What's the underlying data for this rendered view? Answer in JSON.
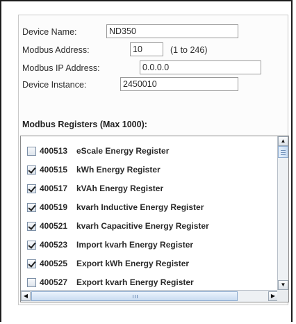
{
  "device": {
    "name_label": "Device Name:",
    "name_value": "ND350",
    "modbus_address_label": "Modbus Address:",
    "modbus_address_value": "10",
    "modbus_address_range": "(1 to 246)",
    "modbus_ip_label": "Modbus IP Address:",
    "modbus_ip_value": "0.0.0.0",
    "instance_label": "Device Instance:",
    "instance_value": "2450010"
  },
  "registers": {
    "title": "Modbus Registers (Max 1000):",
    "items": [
      {
        "number": "400513",
        "name": "eScale Energy Register",
        "checked": false
      },
      {
        "number": "400515",
        "name": "kWh Energy Register",
        "checked": true
      },
      {
        "number": "400517",
        "name": "kVAh Energy Register",
        "checked": true
      },
      {
        "number": "400519",
        "name": "kvarh Inductive Energy Register",
        "checked": true
      },
      {
        "number": "400521",
        "name": "kvarh Capacitive Energy Register",
        "checked": true
      },
      {
        "number": "400523",
        "name": "Import kvarh Energy Register",
        "checked": true
      },
      {
        "number": "400525",
        "name": "Export kWh Energy Register",
        "checked": true
      },
      {
        "number": "400527",
        "name": "Export kvarh Energy Register",
        "checked": false
      }
    ]
  },
  "icons": {
    "scroll_up": "arrow-up-icon",
    "scroll_down": "arrow-down-icon",
    "scroll_left": "arrow-left-icon",
    "scroll_right": "arrow-right-icon"
  },
  "colors": {
    "checkbox_border": "#7c8fa6",
    "scroll_thumb": "#c8dcf2"
  }
}
